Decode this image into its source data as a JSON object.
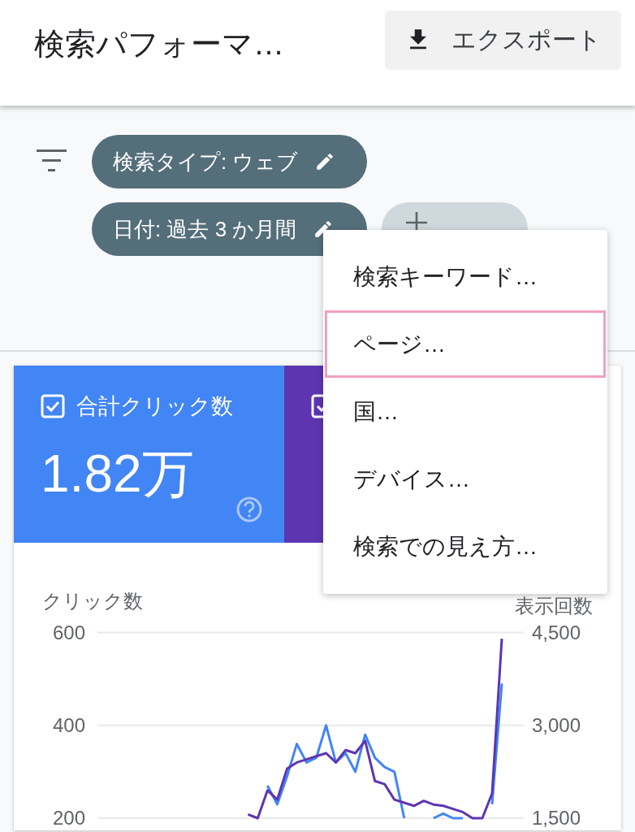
{
  "header": {
    "title": "検索パフォーマ…",
    "export_button": "エクスポート"
  },
  "filters": {
    "chips": [
      {
        "kind": "filter",
        "label": "検索タイプ: ウェブ"
      },
      {
        "kind": "filter",
        "label": "日付: 過去 3 か月間"
      },
      {
        "kind": "new"
      }
    ]
  },
  "menu": {
    "items": [
      {
        "label": "検索キーワード…",
        "selected": false
      },
      {
        "label": "ページ…",
        "selected": true
      },
      {
        "label": "国…",
        "selected": false
      },
      {
        "label": "デバイス…",
        "selected": false
      },
      {
        "label": "検索での見え方…",
        "selected": false
      }
    ]
  },
  "metrics": [
    {
      "label": "合計クリック数",
      "value": "1.82万",
      "checked": true,
      "color": "#4285f4"
    },
    {
      "checked": true,
      "color": "#5e35b1"
    }
  ],
  "chart": {
    "chart_data": {
      "type": "line",
      "ylabel": "クリック数",
      "y2label": "表示回数",
      "ylim": [
        200,
        600
      ],
      "y2lim": [
        1500,
        4500
      ],
      "yticks": [
        200,
        400,
        600
      ],
      "y2ticks": [
        {
          "value": 1500,
          "label": "1,500"
        },
        {
          "value": 3000,
          "label": "3,000"
        },
        {
          "value": 4500,
          "label": "4,500"
        }
      ],
      "series": [
        {
          "color": "#4285f4",
          "values": [
            null,
            null,
            null,
            null,
            null,
            null,
            null,
            null,
            null,
            null,
            null,
            null,
            null,
            null,
            null,
            null,
            null,
            270,
            230,
            290,
            360,
            320,
            330,
            400,
            320,
            340,
            300,
            380,
            330,
            310,
            300,
            200,
            null,
            null,
            200,
            210,
            200,
            200,
            null,
            null,
            230,
            490
          ]
        },
        {
          "color": "#5e35b1",
          "axis": "y2",
          "values": [
            null,
            null,
            null,
            null,
            null,
            null,
            null,
            null,
            null,
            null,
            null,
            null,
            null,
            null,
            null,
            1560,
            1500,
            1950,
            1800,
            2300,
            2400,
            2450,
            2500,
            2550,
            2400,
            2600,
            2550,
            2750,
            2100,
            2050,
            1800,
            1750,
            1700,
            1780,
            1720,
            1700,
            1650,
            1600,
            1500,
            1500,
            1900,
            4400
          ]
        }
      ]
    }
  }
}
